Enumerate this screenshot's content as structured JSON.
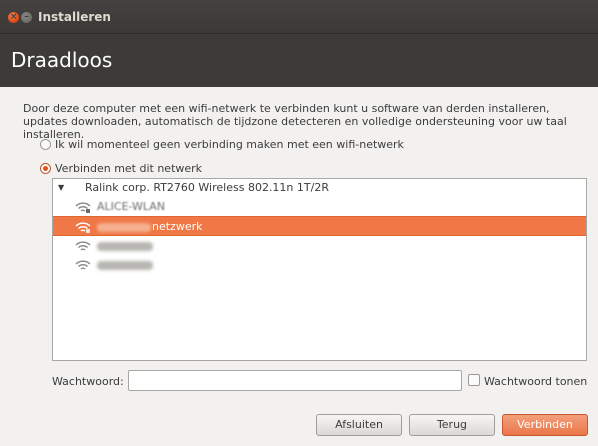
{
  "window": {
    "title": "Installeren"
  },
  "header": {
    "title": "Draadloos"
  },
  "description": "Door deze computer met een wifi-netwerk te verbinden kunt u software van derden installeren, updates downloaden, automatisch de tijdzone detecteren en volledige ondersteuning voor uw taal installeren.",
  "options": {
    "no_connection": {
      "label": "Ik wil momenteel geen verbinding maken met een wifi-netwerk",
      "selected": false
    },
    "connect": {
      "label": "Verbinden met dit netwerk",
      "selected": true
    }
  },
  "networks": {
    "adapter": "Ralink corp. RT2760 Wireless 802.11n 1T/2R",
    "items": [
      {
        "name_visible": "ALICE-WLAN",
        "selected": false
      },
      {
        "name_visible": "netzwerk",
        "selected": true
      },
      {
        "name_visible": "",
        "selected": false
      },
      {
        "name_visible": "",
        "selected": false
      }
    ]
  },
  "password": {
    "label": "Wachtwoord:",
    "value": "",
    "show_label": "Wachtwoord tonen",
    "show_checked": false
  },
  "buttons": {
    "quit": "Afsluiten",
    "back": "Terug",
    "connect": "Verbinden"
  },
  "colors": {
    "accent": "#f07746",
    "header_bg": "#3c3b37",
    "close_button": "#df4a16"
  },
  "icons": {
    "close": "close-icon",
    "minimize": "minimize-icon",
    "expander": "triangle-down-icon",
    "wifi": "wifi-signal-icon"
  }
}
